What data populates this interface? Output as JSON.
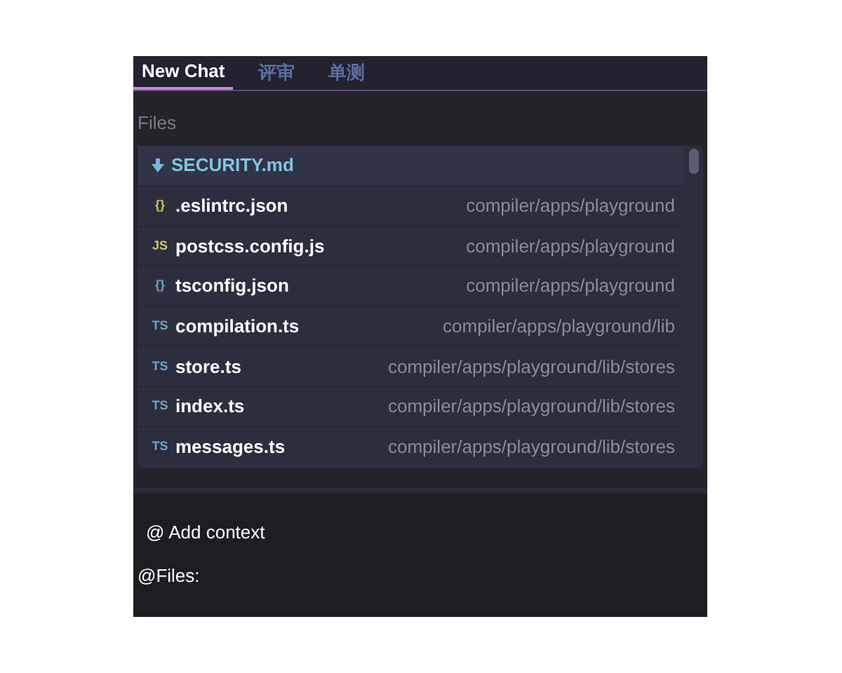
{
  "tabs": [
    {
      "label": "New Chat",
      "selected": true
    },
    {
      "label": "评审",
      "selected": false
    },
    {
      "label": "单测",
      "selected": false
    }
  ],
  "files_heading": "Files",
  "files": [
    {
      "kind": "md",
      "name": "SECURITY.md",
      "selected": true,
      "color": "#7fb6d6"
    },
    {
      "kind": "code",
      "icon": "{}",
      "name": ".eslintrc.json",
      "path": "compiler/apps/playground",
      "selected": false,
      "color": "#d6c15a"
    },
    {
      "kind": "code",
      "icon": "JS",
      "name": "postcss.config.js",
      "path": "compiler/apps/playground",
      "selected": false,
      "color": "#d6c15a"
    },
    {
      "kind": "code",
      "icon": "{}",
      "name": "tsconfig.json",
      "path": "compiler/apps/playground",
      "selected": false,
      "color": "#6fa0c8"
    },
    {
      "kind": "code",
      "icon": "TS",
      "name": "compilation.ts",
      "path": "compiler/apps/playground/lib",
      "selected": false,
      "color": "#6fa0c8"
    },
    {
      "kind": "code",
      "icon": "TS",
      "name": "store.ts",
      "path": "compiler/apps/playground/lib/stores",
      "selected": false,
      "color": "#6fa0c8"
    },
    {
      "kind": "code",
      "icon": "TS",
      "name": "index.ts",
      "path": "compiler/apps/playground/lib/stores",
      "selected": false,
      "color": "#6fa0c8"
    },
    {
      "kind": "code",
      "icon": "TS",
      "name": "messages.ts",
      "path": "compiler/apps/playground/lib/stores",
      "selected": false,
      "color": "#6fa0c8"
    }
  ],
  "add_context": "@ Add context",
  "input_value": "@Files:"
}
